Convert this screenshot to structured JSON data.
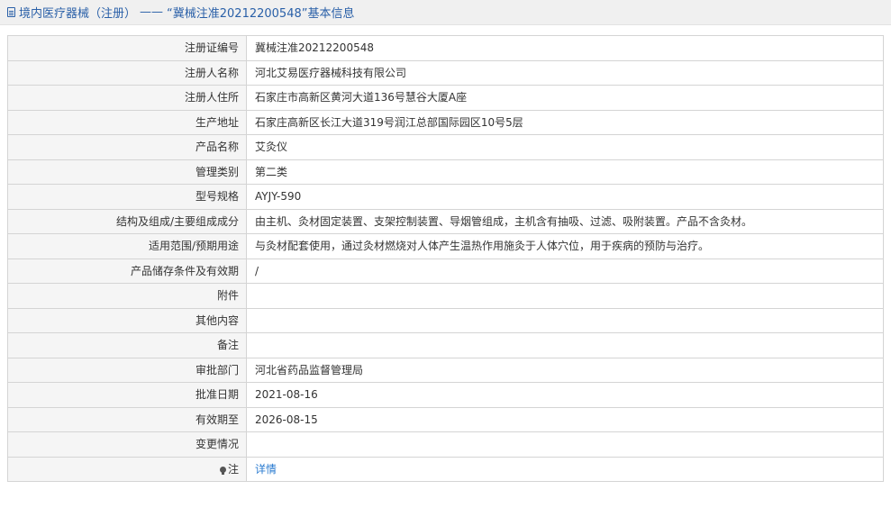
{
  "header": {
    "category": "境内医疗器械（注册）",
    "separator": "——",
    "record_title": "“冀械注准20212200548”基本信息"
  },
  "rows": [
    {
      "label": "注册证编号",
      "value": "冀械注准20212200548"
    },
    {
      "label": "注册人名称",
      "value": "河北艾易医疗器械科技有限公司"
    },
    {
      "label": "注册人住所",
      "value": "石家庄市高新区黄河大道136号慧谷大厦A座"
    },
    {
      "label": "生产地址",
      "value": "石家庄高新区长江大道319号润江总部国际园区10号5层"
    },
    {
      "label": "产品名称",
      "value": "艾灸仪"
    },
    {
      "label": "管理类别",
      "value": "第二类"
    },
    {
      "label": "型号规格",
      "value": "AYJY-590"
    },
    {
      "label": "结构及组成/主要组成成分",
      "value": "由主机、灸材固定装置、支架控制装置、导烟管组成，主机含有抽吸、过滤、吸附装置。产品不含灸材。"
    },
    {
      "label": "适用范围/预期用途",
      "value": "与灸材配套使用，通过灸材燃烧对人体产生温热作用施灸于人体穴位，用于疾病的预防与治疗。"
    },
    {
      "label": "产品储存条件及有效期",
      "value": "/"
    },
    {
      "label": "附件",
      "value": ""
    },
    {
      "label": "其他内容",
      "value": ""
    },
    {
      "label": "备注",
      "value": ""
    },
    {
      "label": "审批部门",
      "value": "河北省药品监督管理局"
    },
    {
      "label": "批准日期",
      "value": "2021-08-16"
    },
    {
      "label": "有效期至",
      "value": "2026-08-15"
    },
    {
      "label": "变更情况",
      "value": ""
    }
  ],
  "note_row": {
    "label": "注",
    "link_text": "详情"
  },
  "icons": {
    "header_icon": "document-icon",
    "note_icon": "lightbulb-icon"
  },
  "colors": {
    "link": "#2a7bd0",
    "title": "#2a60a8",
    "label_bg": "#f5f5f5",
    "border": "#d4d4d4"
  }
}
